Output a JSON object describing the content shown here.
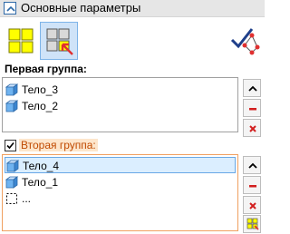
{
  "header": {
    "title": "Основные параметры"
  },
  "group1": {
    "label": "Первая группа:",
    "items": [
      {
        "label": "Тело_3"
      },
      {
        "label": "Тело_2"
      }
    ]
  },
  "group2": {
    "label": "Вторая группа:",
    "checked": true,
    "items": [
      {
        "label": "Тело_4",
        "selected": true
      },
      {
        "label": "Тело_1"
      },
      {
        "label": "..."
      }
    ]
  },
  "icons": {
    "collapse": "chevron-up-icon",
    "select_objects": "yellow-grid-icon",
    "select_with_cursor": "grid-cursor-icon",
    "graph_check": "graph-check-icon",
    "body": "cube-icon",
    "empty_slot": "dashed-square-icon",
    "move_up": "chevron-up-icon",
    "delete_red": "minus-icon",
    "delete_cross": "x-icon",
    "pick": "grid-cursor-icon"
  },
  "colors": {
    "accent": "#2f6aa8",
    "selected_bg": "#dbeeff",
    "group2_highlight": "#fde6cc",
    "group2_text": "#c04a00",
    "delete_red": "#d21f1f"
  }
}
